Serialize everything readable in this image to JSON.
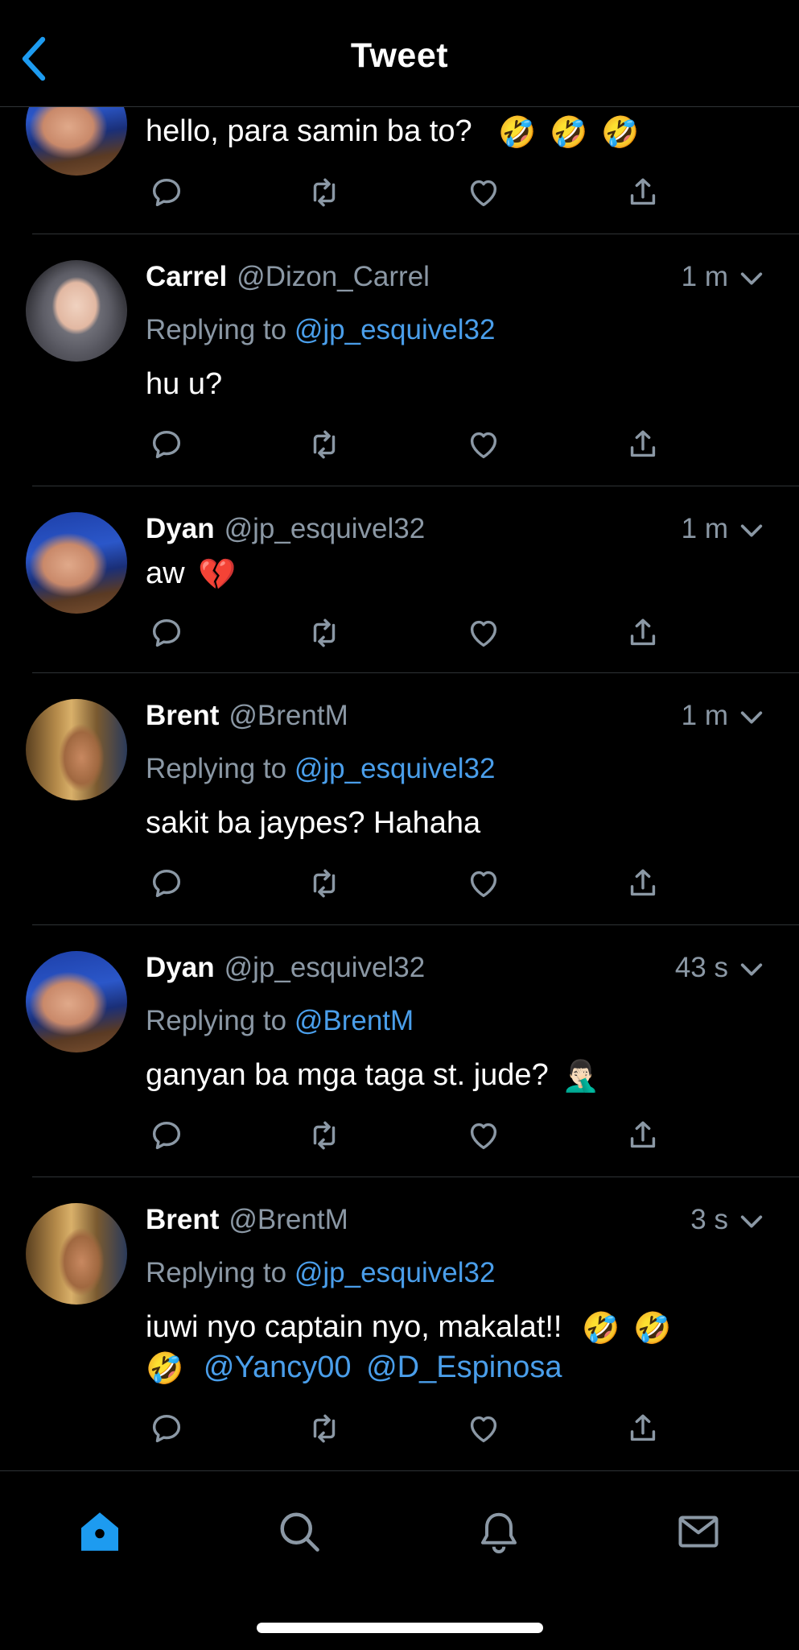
{
  "header": {
    "title": "Tweet",
    "back_icon": "chevron-left-icon",
    "accent": "#1d9bf0"
  },
  "colors": {
    "background": "#000000",
    "secondary_text": "#8b98a5",
    "mention": "#4a9eea",
    "divider": "#2f3336"
  },
  "tweets": [
    {
      "partial": true,
      "avatar": "dyan-avatar",
      "text": "hello, para samin ba to?",
      "emojis": [
        "🤣",
        "🤣",
        "🤣"
      ]
    },
    {
      "name": "Carrel",
      "handle": "@Dizon_Carrel",
      "time": "1 m",
      "avatar": "carrel-avatar",
      "replying_prefix": "Replying to",
      "replying_to": "@jp_esquivel32",
      "text": "hu u?"
    },
    {
      "name": "Dyan",
      "handle": "@jp_esquivel32",
      "time": "1 m",
      "avatar": "dyan-avatar",
      "text": "aw",
      "emojis": [
        "💔"
      ]
    },
    {
      "name": "Brent",
      "handle": "@BrentM",
      "time": "1 m",
      "avatar": "brent-avatar",
      "replying_prefix": "Replying to",
      "replying_to": "@jp_esquivel32",
      "text": "sakit ba jaypes? Hahaha"
    },
    {
      "name": "Dyan",
      "handle": "@jp_esquivel32",
      "time": "43 s",
      "avatar": "dyan-avatar",
      "replying_prefix": "Replying to",
      "replying_to": "@BrentM",
      "text": "ganyan ba mga taga st. jude?",
      "emojis": [
        "🤦🏻‍♂️"
      ]
    },
    {
      "name": "Brent",
      "handle": "@BrentM",
      "time": "3 s",
      "avatar": "brent-avatar",
      "replying_prefix": "Replying to",
      "replying_to": "@jp_esquivel32",
      "text": "iuwi nyo captain nyo, makalat!!",
      "emojis": [
        "🤣",
        "🤣",
        "🤣"
      ],
      "mentions": [
        "@Yancy00",
        "@D_Espinosa"
      ]
    }
  ],
  "action_icons": [
    "reply-icon",
    "retweet-icon",
    "like-icon",
    "share-icon"
  ],
  "tabbar": {
    "tabs": [
      {
        "icon": "home-icon",
        "active": true
      },
      {
        "icon": "search-icon",
        "active": false
      },
      {
        "icon": "notifications-icon",
        "active": false
      },
      {
        "icon": "messages-icon",
        "active": false
      }
    ]
  }
}
